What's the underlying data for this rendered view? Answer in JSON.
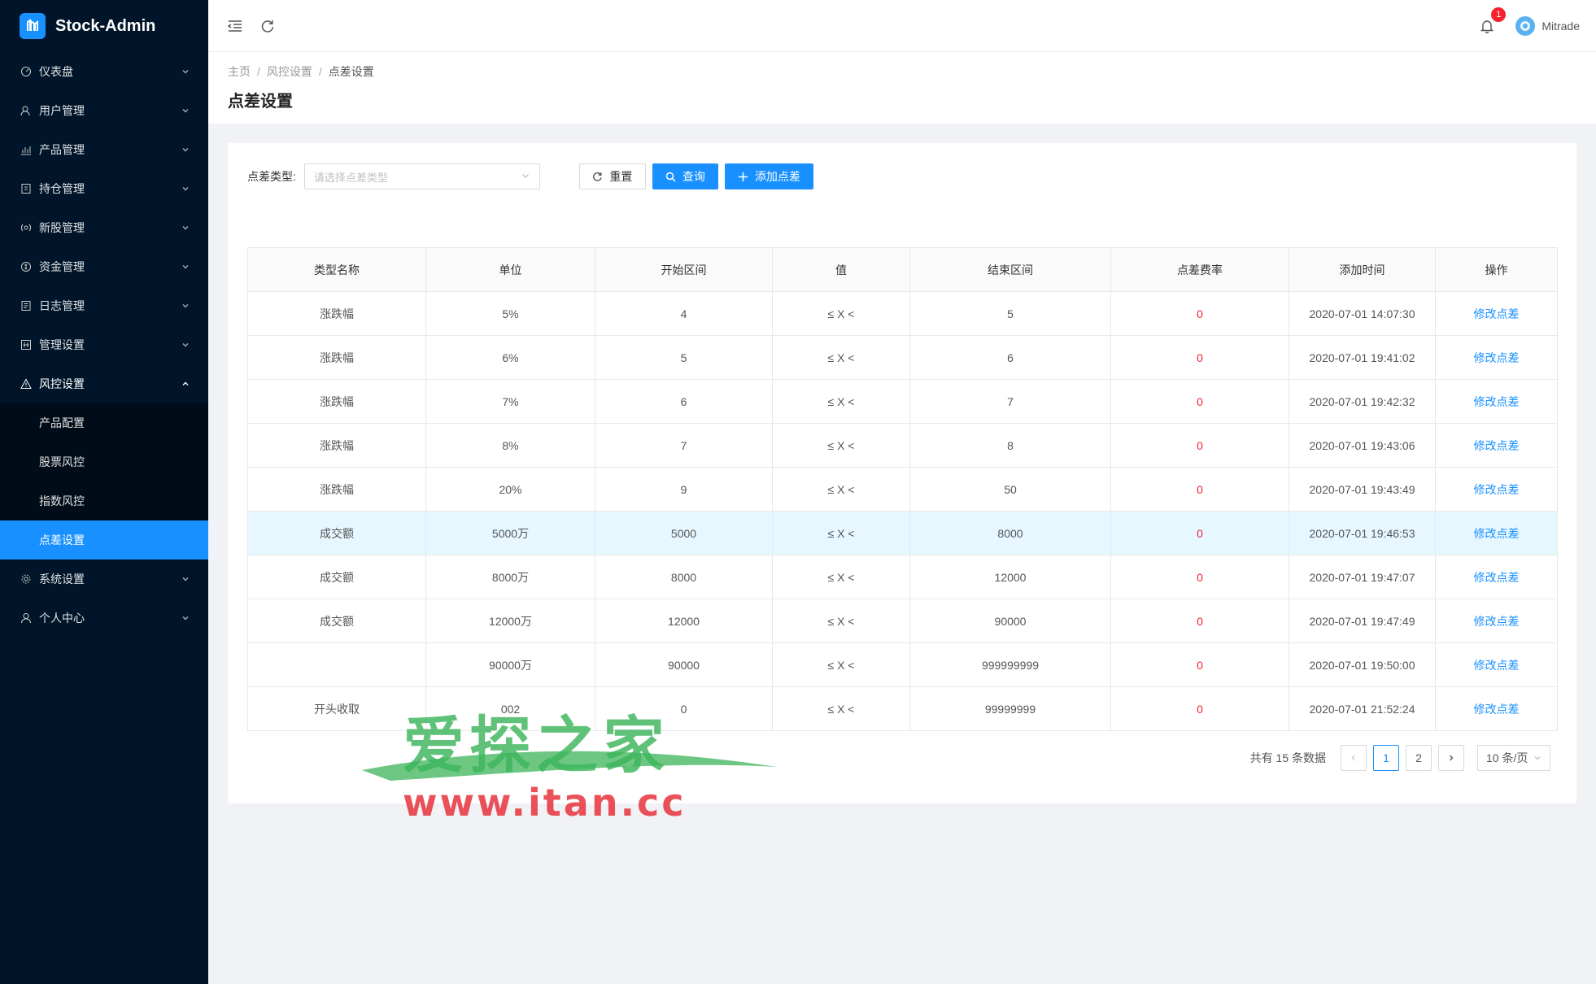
{
  "app": {
    "title": "Stock-Admin"
  },
  "sidebar": {
    "items": [
      {
        "label": "仪表盘",
        "icon": "dashboard-icon"
      },
      {
        "label": "用户管理",
        "icon": "users-icon"
      },
      {
        "label": "产品管理",
        "icon": "chart-icon"
      },
      {
        "label": "持仓管理",
        "icon": "holdings-icon"
      },
      {
        "label": "新股管理",
        "icon": "ipo-icon"
      },
      {
        "label": "资金管理",
        "icon": "money-icon"
      },
      {
        "label": "日志管理",
        "icon": "log-icon"
      },
      {
        "label": "管理设置",
        "icon": "admin-icon"
      },
      {
        "label": "风控设置",
        "icon": "warning-icon"
      }
    ],
    "risk_submenu": [
      {
        "label": "产品配置"
      },
      {
        "label": "股票风控"
      },
      {
        "label": "指数风控"
      },
      {
        "label": "点差设置"
      }
    ],
    "bottom_items": [
      {
        "label": "系统设置",
        "icon": "gear-icon"
      },
      {
        "label": "个人中心",
        "icon": "user-icon"
      }
    ]
  },
  "header": {
    "notification_count": "1",
    "username": "Mitrade"
  },
  "breadcrumb": {
    "home": "主页",
    "parent": "风控设置",
    "current": "点差设置"
  },
  "page": {
    "title": "点差设置"
  },
  "filter": {
    "label": "点差类型:",
    "placeholder": "请选择点差类型",
    "reset_label": "重置",
    "query_label": "查询",
    "add_label": "添加点差"
  },
  "table": {
    "columns": [
      "类型名称",
      "单位",
      "开始区间",
      "值",
      "结束区间",
      "点差费率",
      "添加时间",
      "操作"
    ],
    "rows": [
      {
        "type": "涨跌幅",
        "unit": "5%",
        "start": "4",
        "op": "≤ X <",
        "end": "5",
        "rate": "0",
        "time": "2020-07-01 14:07:30",
        "action": "修改点差"
      },
      {
        "type": "涨跌幅",
        "unit": "6%",
        "start": "5",
        "op": "≤ X <",
        "end": "6",
        "rate": "0",
        "time": "2020-07-01 19:41:02",
        "action": "修改点差"
      },
      {
        "type": "涨跌幅",
        "unit": "7%",
        "start": "6",
        "op": "≤ X <",
        "end": "7",
        "rate": "0",
        "time": "2020-07-01 19:42:32",
        "action": "修改点差"
      },
      {
        "type": "涨跌幅",
        "unit": "8%",
        "start": "7",
        "op": "≤ X <",
        "end": "8",
        "rate": "0",
        "time": "2020-07-01 19:43:06",
        "action": "修改点差"
      },
      {
        "type": "涨跌幅",
        "unit": "20%",
        "start": "9",
        "op": "≤ X <",
        "end": "50",
        "rate": "0",
        "time": "2020-07-01 19:43:49",
        "action": "修改点差"
      },
      {
        "type": "成交额",
        "unit": "5000万",
        "start": "5000",
        "op": "≤ X <",
        "end": "8000",
        "rate": "0",
        "time": "2020-07-01 19:46:53",
        "action": "修改点差"
      },
      {
        "type": "成交额",
        "unit": "8000万",
        "start": "8000",
        "op": "≤ X <",
        "end": "12000",
        "rate": "0",
        "time": "2020-07-01 19:47:07",
        "action": "修改点差"
      },
      {
        "type": "成交额",
        "unit": "12000万",
        "start": "12000",
        "op": "≤ X <",
        "end": "90000",
        "rate": "0",
        "time": "2020-07-01 19:47:49",
        "action": "修改点差"
      },
      {
        "type": "",
        "unit": "90000万",
        "start": "90000",
        "op": "≤ X <",
        "end": "999999999",
        "rate": "0",
        "time": "2020-07-01 19:50:00",
        "action": "修改点差"
      },
      {
        "type": "开头收取",
        "unit": "002",
        "start": "0",
        "op": "≤ X <",
        "end": "99999999",
        "rate": "0",
        "time": "2020-07-01 21:52:24",
        "action": "修改点差"
      }
    ]
  },
  "pagination": {
    "total_text": "共有 15 条数据",
    "pages": [
      "1",
      "2"
    ],
    "current": "1",
    "page_size": "10 条/页"
  },
  "watermark": {
    "title": "爱探之家",
    "url": "www.itan.cc"
  },
  "colors": {
    "sidebar_bg": "#001529",
    "primary": "#1890ff",
    "danger": "#f5222d"
  }
}
